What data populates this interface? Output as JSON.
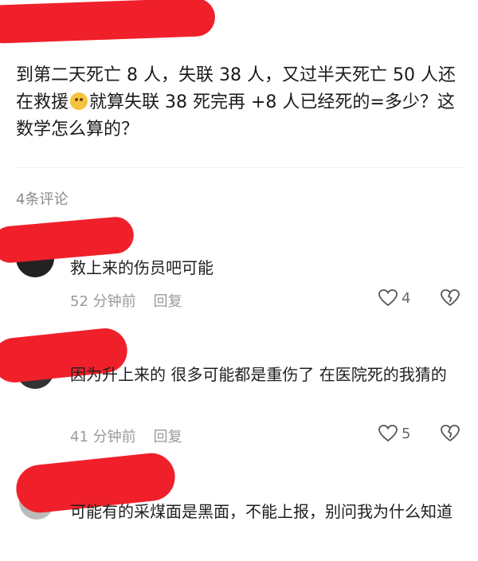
{
  "post": {
    "text": "到第二天死亡 8 人，失联 38 人，又过半天死亡 50 人还在救援",
    "text_after_emoji": "就算失联 38 死完再 +8 人已经死的=多少？这数学怎么算的？",
    "emoji_icon": "sweat-smile-emoji"
  },
  "comments_header": {
    "count_label": "4条评论"
  },
  "comments": [
    {
      "text": "救上来的伤员吧可能",
      "time": "52 分钟前",
      "reply_label": "回复",
      "likes": "4"
    },
    {
      "text": "因为升上来的 很多可能都是重伤了 在医院死的我猜的",
      "time": "41 分钟前",
      "reply_label": "回复",
      "likes": "5"
    },
    {
      "text": "可能有的采煤面是黑面，不能上报，别问我为什么知道"
    }
  ],
  "colors": {
    "redaction": "#f0202a",
    "meta_gray": "#9a9a9a"
  },
  "icons": {
    "like": "heart-outline-icon",
    "dislike": "broken-heart-icon"
  }
}
